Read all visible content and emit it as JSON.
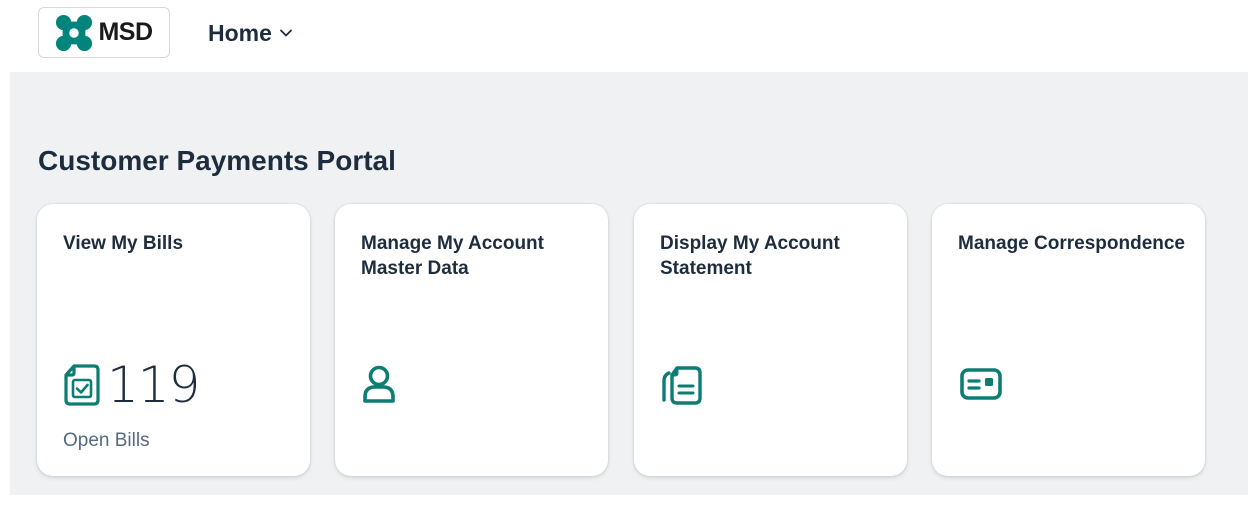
{
  "header": {
    "logo_text": "MSD",
    "home_label": "Home"
  },
  "page": {
    "title": "Customer Payments Portal"
  },
  "tiles": [
    {
      "title": "View My Bills",
      "icon": "document-check-icon",
      "kpi_value": "119",
      "footer": "Open Bills"
    },
    {
      "title": "Manage My Account Master Data",
      "icon": "person-icon"
    },
    {
      "title": "Display My Account Statement",
      "icon": "documents-icon"
    },
    {
      "title": "Manage Correspondence",
      "icon": "id-card-icon"
    }
  ],
  "colors": {
    "accent": "#0b7d73",
    "logo_teal": "#00857c",
    "text": "#1d2d3e",
    "muted_text": "#556b82",
    "background": "#f0f1f2"
  }
}
